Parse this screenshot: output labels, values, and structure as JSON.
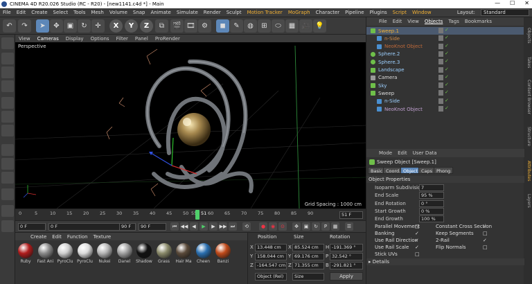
{
  "window": {
    "title": "CINEMA 4D R20.026 Studio (RC - R20) - [new1141.c4d *] - Main",
    "controls": [
      "—",
      "☐",
      "✕"
    ]
  },
  "menubar": {
    "items": [
      "File",
      "Edit",
      "Create",
      "Select",
      "Tools",
      "Mesh",
      "Volume",
      "Snap",
      "Animate",
      "Simulate",
      "Render",
      "Sculpt",
      "Motion Tracker",
      "MoGraph",
      "Character",
      "Pipeline",
      "Plugins",
      "Script",
      "Window"
    ],
    "layout_label": "Layout:",
    "layout_value": "Standard"
  },
  "toolbar": {
    "xyz": [
      "X",
      "Y",
      "Z"
    ]
  },
  "viewport": {
    "menu": [
      "View",
      "Cameras",
      "Display",
      "Options",
      "Filter",
      "Panel",
      "ProRender"
    ],
    "label": "Perspective",
    "grid_spacing": "Grid Spacing : 1000 cm"
  },
  "timeline": {
    "ticks": [
      "0",
      "5",
      "10",
      "15",
      "20",
      "25",
      "30",
      "35",
      "40",
      "45",
      "50",
      "55",
      "60",
      "65",
      "70",
      "75",
      "80",
      "85",
      "90"
    ],
    "current": "51",
    "current_field": "51 F"
  },
  "transport": {
    "start": "0 F",
    "start2": "0 F",
    "end": "90 F",
    "end2": "90 F"
  },
  "material_manager": {
    "menu": [
      "Create",
      "Edit",
      "Function",
      "Texture"
    ],
    "materials": [
      {
        "name": "Ruby",
        "color": "#b01c1c"
      },
      {
        "name": "Fast Ani",
        "color": "#8a8a8a"
      },
      {
        "name": "PyroClu",
        "color": "#cfcfcf"
      },
      {
        "name": "PyroClu",
        "color": "#dcdcdc"
      },
      {
        "name": "Nukei",
        "color": "#b5b5b5"
      },
      {
        "name": "Danel",
        "color": "#a0a0a0"
      },
      {
        "name": "Shadow",
        "color": "#111111"
      },
      {
        "name": "Grass",
        "color": "#8a8a6a"
      },
      {
        "name": "Hair Ma",
        "color": "#5a4a3a"
      },
      {
        "name": "Cheen",
        "color": "#2a6fb0"
      },
      {
        "name": "Banzi",
        "color": "#c04a1a"
      }
    ]
  },
  "coordinates": {
    "headers": [
      "Position",
      "Size",
      "Rotation"
    ],
    "rows": [
      {
        "axis": "X",
        "pos": "13.448 cm",
        "size": "85.524 cm",
        "rot_axis": "H",
        "rot": "-191.369 °"
      },
      {
        "axis": "Y",
        "pos": "158.044 cm",
        "size": "69.176 cm",
        "rot_axis": "P",
        "rot": "32.542 °"
      },
      {
        "axis": "Z",
        "pos": "-164.547 cm",
        "size": "71.355 cm",
        "rot_axis": "B",
        "rot": "-291.821 °"
      }
    ],
    "mode": "Object (Rel)",
    "size_mode": "Size",
    "apply": "Apply"
  },
  "object_manager": {
    "menu": [
      "File",
      "Edit",
      "View",
      "Objects",
      "Tags",
      "Bookmarks"
    ],
    "objects": [
      {
        "name": "Sweep.1",
        "color": "#f2b134",
        "indent": 0,
        "icon": "sweep",
        "selected": true
      },
      {
        "name": "n-Side",
        "color": "#d08b4a",
        "indent": 1,
        "icon": "spline"
      },
      {
        "name": "NeoKnot Object",
        "color": "#c06a3a",
        "indent": 1,
        "icon": "spline"
      },
      {
        "name": "Sphere.2",
        "color": "#9dd0ff",
        "indent": 0,
        "icon": "sphere"
      },
      {
        "name": "Sphere.3",
        "color": "#9dd0ff",
        "indent": 0,
        "icon": "sphere"
      },
      {
        "name": "Landscape",
        "color": "#9dd0ff",
        "indent": 0,
        "icon": "landscape"
      },
      {
        "name": "Camera",
        "color": "#ddd",
        "indent": 0,
        "icon": "camera"
      },
      {
        "name": "Sky",
        "color": "#9dd0ff",
        "indent": 0,
        "icon": "sky"
      },
      {
        "name": "Sweep",
        "color": "#ddd",
        "indent": 0,
        "icon": "sweep"
      },
      {
        "name": "n-Side",
        "color": "#9dd0ff",
        "indent": 1,
        "icon": "spline"
      },
      {
        "name": "NeoKnot Object",
        "color": "#c0a0d0",
        "indent": 1,
        "icon": "spline"
      }
    ]
  },
  "side_tabs": [
    "Objects",
    "Takes",
    "Content Browser",
    "Structure",
    "Attributes",
    "Layers"
  ],
  "attributes": {
    "menu": [
      "Mode",
      "Edit",
      "User Data"
    ],
    "object_title": "Sweep Object [Sweep.1]",
    "tabs": [
      "Basic",
      "Coord.",
      "Object",
      "Caps",
      "Phong"
    ],
    "active_tab": "Object",
    "section": "Object Properties",
    "props": [
      {
        "label": "Isoparm Subdivision",
        "value": "7"
      },
      {
        "label": "End Scale",
        "value": "95 %"
      },
      {
        "label": "End Rotation",
        "value": "0 °"
      },
      {
        "label": "Start Growth",
        "value": "0 %"
      },
      {
        "label": "End Growth",
        "value": "100 %"
      }
    ],
    "checks_left": [
      {
        "label": "Parallel Movement",
        "checked": false
      },
      {
        "label": "Banking",
        "checked": true
      },
      {
        "label": "Use Rail Direction",
        "checked": true
      },
      {
        "label": "Use Rail Scale",
        "checked": true
      },
      {
        "label": "Stick UVs",
        "checked": false
      }
    ],
    "checks_right": [
      {
        "label": "Constant Cross Section",
        "checked": true
      },
      {
        "label": "Keep Segments",
        "checked": false
      },
      {
        "label": "2-Rail",
        "checked": true
      },
      {
        "label": "Flip Normals",
        "checked": false
      }
    ],
    "details": "Details"
  }
}
